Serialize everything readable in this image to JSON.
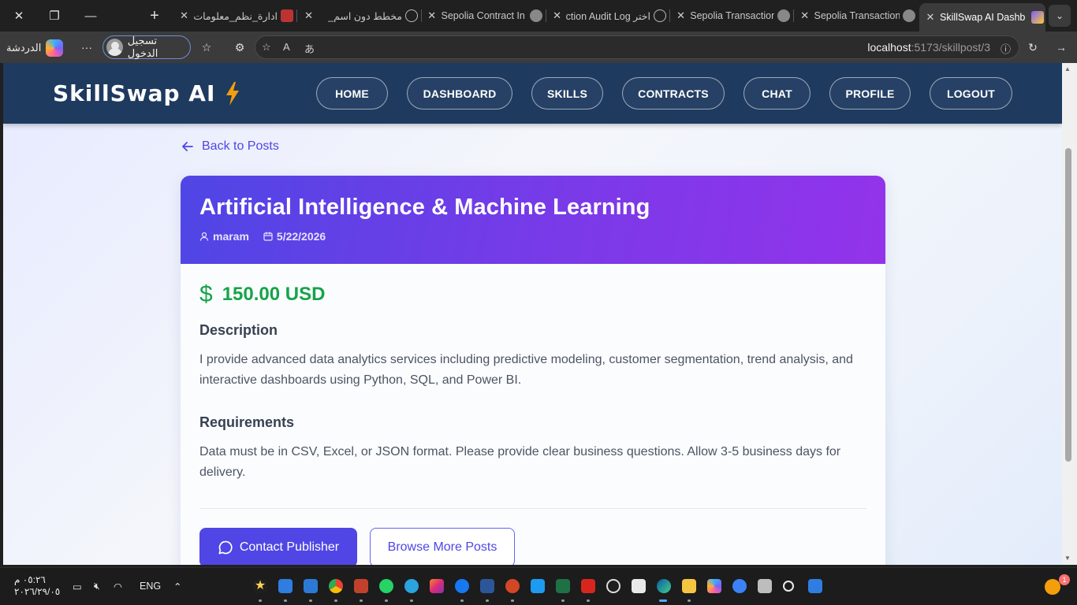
{
  "browser": {
    "tabs": [
      {
        "title": "ادارة_نظم_معلومات"
      },
      {
        "title": "مخطط دون اسم_"
      },
      {
        "title": "Sepolia Contract In"
      },
      {
        "title": "اختر Action Audit Log"
      },
      {
        "title": "Sepolia Transaction"
      },
      {
        "title": "Sepolia Transaction"
      },
      {
        "title": "SkillSwap AI Dashb"
      }
    ],
    "chat_label": "الدردشة",
    "more_label": "···",
    "signin_label": "تسجيل الدخول",
    "url_host": "localhost",
    "url_path": ":5173/skillpost/3"
  },
  "app": {
    "brand": "SkillSwap AI",
    "nav": [
      "HOME",
      "DASHBOARD",
      "SKILLS",
      "CONTRACTS",
      "CHAT",
      "PROFILE",
      "LOGOUT"
    ]
  },
  "post": {
    "back_label": "Back to Posts",
    "title": "Artificial Intelligence & Machine Learning",
    "author": "maram",
    "date": "5/22/2026",
    "price": "150.00 USD",
    "description_heading": "Description",
    "description": "I provide advanced data analytics services including predictive modeling, customer segmentation, trend analysis, and interactive dashboards using Python, SQL, and Power BI.",
    "requirements_heading": "Requirements",
    "requirements": "Data must be in CSV, Excel, or JSON format. Please provide clear business questions. Allow 3-5 business days for delivery.",
    "contact_label": "Contact Publisher",
    "browse_label": "Browse More Posts"
  },
  "taskbar": {
    "time": "٠٥:٢٦ م",
    "date": "٢٠٢٦/٢٩/٠٥",
    "language": "ENG",
    "notification_count": "1"
  },
  "colors": {
    "navbar": "#1e3a5f",
    "accent": "#4f46e5",
    "price": "#16a34a",
    "header_gradient_start": "#4f46e5",
    "header_gradient_end": "#9333ea"
  }
}
